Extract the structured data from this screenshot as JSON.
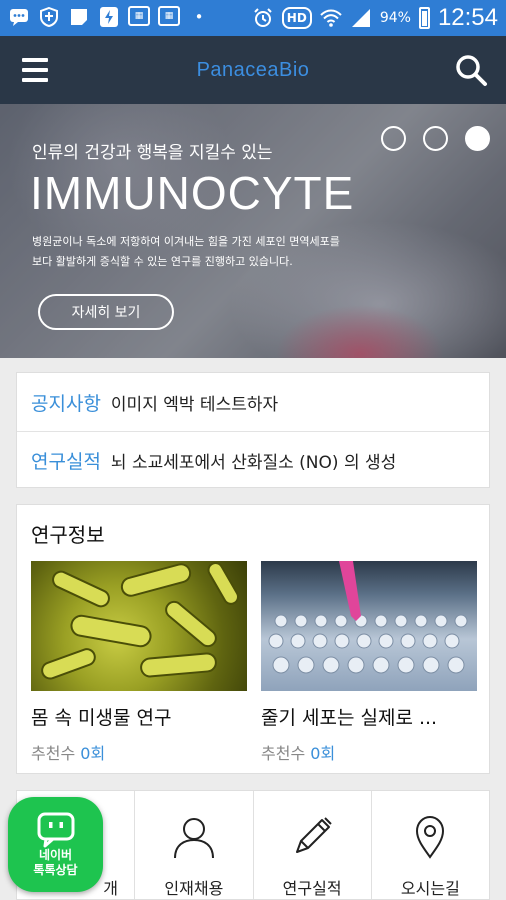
{
  "status_bar": {
    "battery": "94%",
    "time": "12:54",
    "hd_label": "HD"
  },
  "appbar": {
    "brand": "PanaceaBio"
  },
  "hero": {
    "subtitle": "인류의 건강과 행복을 지킬수 있는",
    "title": "IMMUNOCYTE",
    "desc_line1": "병원균이나 독소에 저항하여 이겨내는 힘을 가진 세포인 면역세포를",
    "desc_line2": "보다 활발하게 증식할 수 있는 연구를 진행하고 있습니다.",
    "button_label": "자세히 보기",
    "slide_count": 3,
    "active_slide": 3
  },
  "notices": [
    {
      "category": "공지사항",
      "text": "이미지 엑박 테스트하자"
    },
    {
      "category": "연구실적",
      "text": "뇌 소교세포에서 산화질소 (NO) 의 생성"
    }
  ],
  "research": {
    "title": "연구정보",
    "items": [
      {
        "title": "몸 속 미생물 연구",
        "meta_label": "추천수",
        "count": "0회"
      },
      {
        "title": "줄기 세포는 실제로 ...",
        "meta_label": "추천수",
        "count": "0회"
      }
    ]
  },
  "bottom_nav": [
    {
      "label": "개",
      "icon": "building-icon"
    },
    {
      "label": "인재채용",
      "icon": "person-icon"
    },
    {
      "label": "연구실적",
      "icon": "pen-icon"
    },
    {
      "label": "오시는길",
      "icon": "location-pin-icon"
    }
  ],
  "talk_button": {
    "line1": "네이버",
    "line2": "톡톡상담"
  },
  "colors": {
    "status_bar": "#2f7dd4",
    "app_bar": "#2a3747",
    "brand": "#3c8ee0",
    "accent": "#3a8fd9",
    "talk_green": "#1ec44f"
  }
}
